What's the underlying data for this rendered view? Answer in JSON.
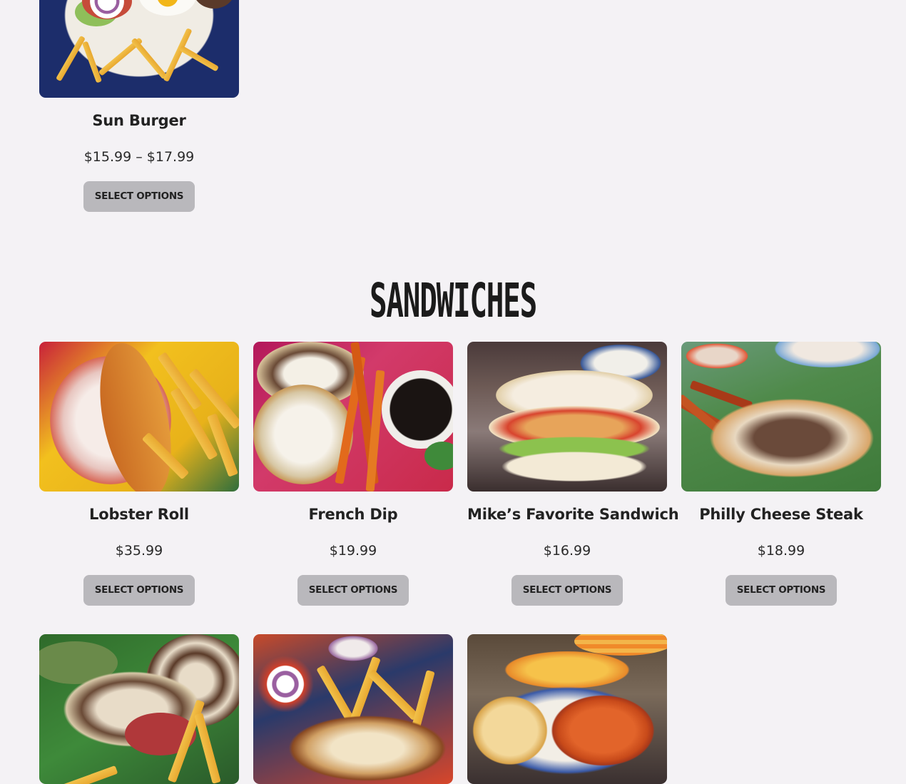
{
  "top_product": {
    "name": "Sun Burger",
    "price": "$15.99 – $17.99",
    "button": "SELECT OPTIONS"
  },
  "section": {
    "title": "SANDWICHES"
  },
  "products": [
    {
      "name": "Lobster Roll",
      "price": "$35.99",
      "button": "SELECT OPTIONS"
    },
    {
      "name": "French Dip",
      "price": "$19.99",
      "button": "SELECT OPTIONS"
    },
    {
      "name": "Mike’s Favorite Sandwich",
      "price": "$16.99",
      "button": "SELECT OPTIONS"
    },
    {
      "name": "Philly Cheese Steak",
      "price": "$18.99",
      "button": "SELECT OPTIONS"
    }
  ],
  "colors": {
    "background": "#f4f2f5",
    "button": "#b9b8bc",
    "text": "#1f1f1f"
  }
}
